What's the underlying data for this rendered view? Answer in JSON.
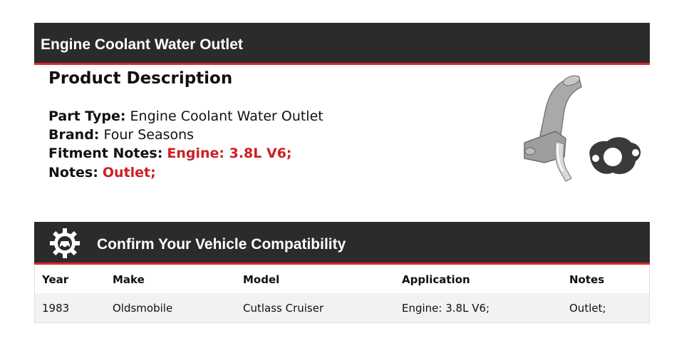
{
  "header": {
    "title": "Engine Coolant Water Outlet"
  },
  "description": {
    "title": "Product Description",
    "part_type_label": "Part Type:",
    "part_type": "Engine Coolant Water Outlet",
    "brand_label": "Brand:",
    "brand": "Four Seasons",
    "fitment_label": "Fitment Notes:",
    "fitment": "Engine: 3.8L V6;",
    "notes_label": "Notes:",
    "notes": "Outlet;",
    "highlight_color": "#cc1f24"
  },
  "compat": {
    "title": "Confirm Your Vehicle Compatibility",
    "icon": "gear-car-icon",
    "columns": [
      "Year",
      "Make",
      "Model",
      "Application",
      "Notes"
    ],
    "rows": [
      [
        "1983",
        "Oldsmobile",
        "Cutlass Cruiser",
        "Engine: 3.8L V6;",
        "Outlet;"
      ]
    ]
  },
  "colors": {
    "bar_bg": "#2b2b2b",
    "accent_red": "#e0242b"
  }
}
